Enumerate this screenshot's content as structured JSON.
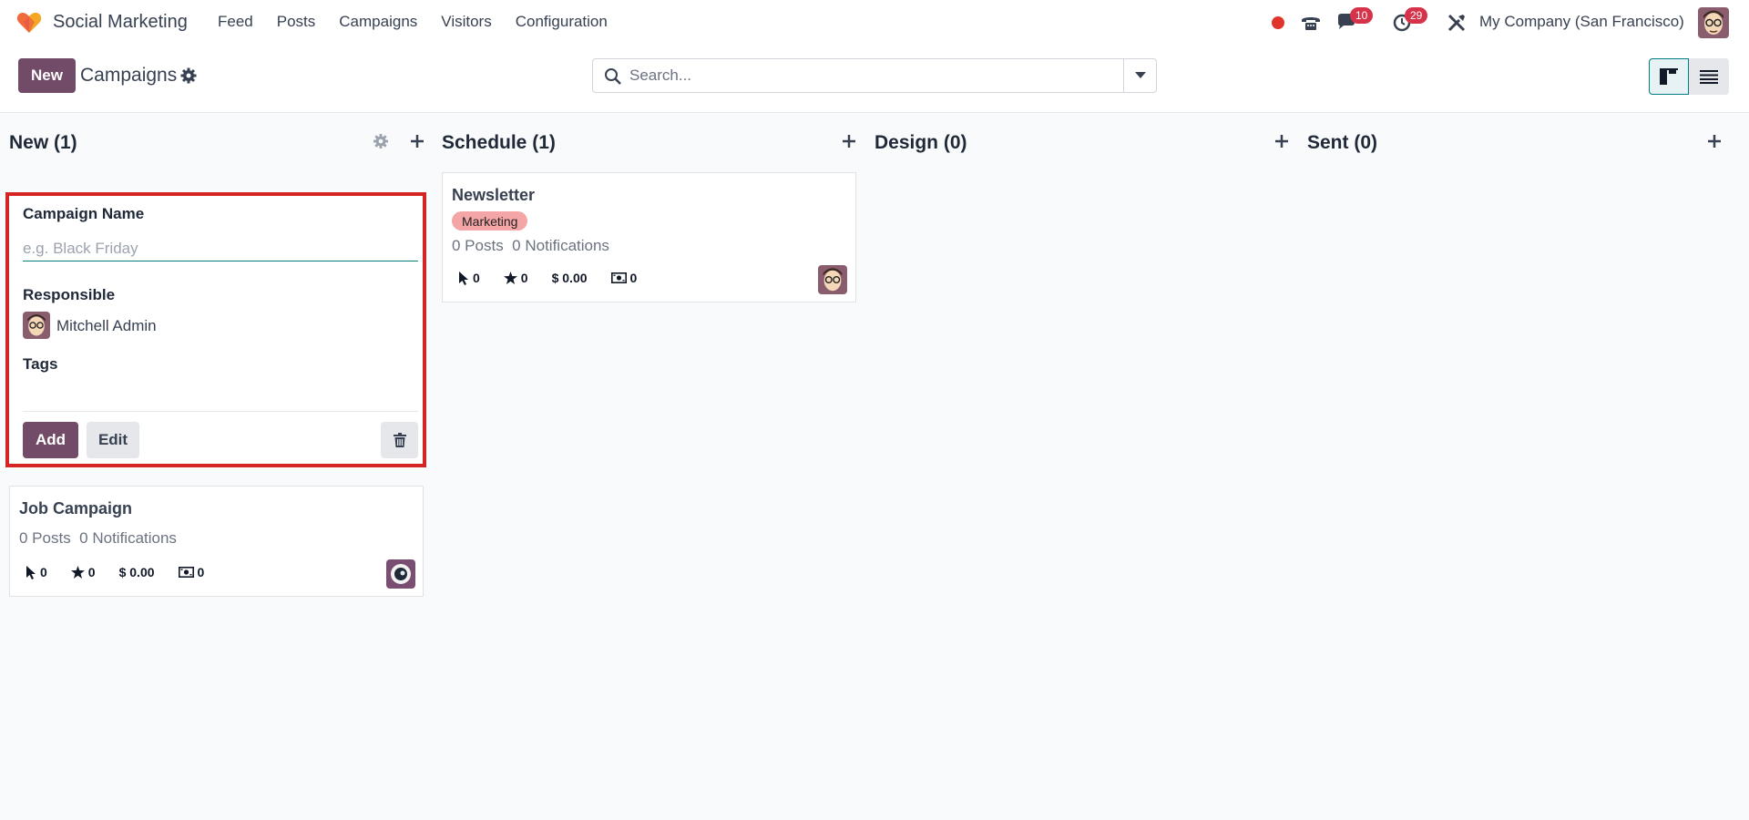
{
  "navbar": {
    "app_name": "Social Marketing",
    "menu": [
      "Feed",
      "Posts",
      "Campaigns",
      "Visitors",
      "Configuration"
    ],
    "messages_count": "10",
    "activities_count": "29",
    "company": "My Company (San Francisco)"
  },
  "control": {
    "new_label": "New",
    "breadcrumb": "Campaigns",
    "search_placeholder": "Search..."
  },
  "columns": [
    {
      "title": "New (1)"
    },
    {
      "title": "Schedule (1)"
    },
    {
      "title": "Design (0)"
    },
    {
      "title": "Sent (0)"
    }
  ],
  "quick_create": {
    "name_label": "Campaign Name",
    "name_placeholder": "e.g. Black Friday",
    "responsible_label": "Responsible",
    "responsible_name": "Mitchell Admin",
    "tags_label": "Tags",
    "add_label": "Add",
    "edit_label": "Edit"
  },
  "cards": [
    {
      "title": "Newsletter",
      "tag": "Marketing",
      "posts": "0 Posts",
      "notifications": "0 Notifications",
      "clicks": "0",
      "stars": "0",
      "revenue": "$ 0.00",
      "cash": "0"
    },
    {
      "title": "Job Campaign",
      "posts": "0 Posts",
      "notifications": "0 Notifications",
      "clicks": "0",
      "stars": "0",
      "revenue": "$ 0.00",
      "cash": "0"
    }
  ],
  "colors": {
    "brand": "#714b67",
    "accent": "#017e84",
    "highlight": "#d42424",
    "tag": "#f4a5a5"
  },
  "icons": [
    "heart-logo-icon",
    "gear-icon",
    "search-icon",
    "caret-down-icon",
    "kanban-view-icon",
    "list-view-icon",
    "plus-icon",
    "trash-icon",
    "cursor-icon",
    "star-icon",
    "money-icon",
    "recording-icon",
    "phone-icon",
    "chat-icon",
    "clock-icon",
    "tools-icon"
  ]
}
